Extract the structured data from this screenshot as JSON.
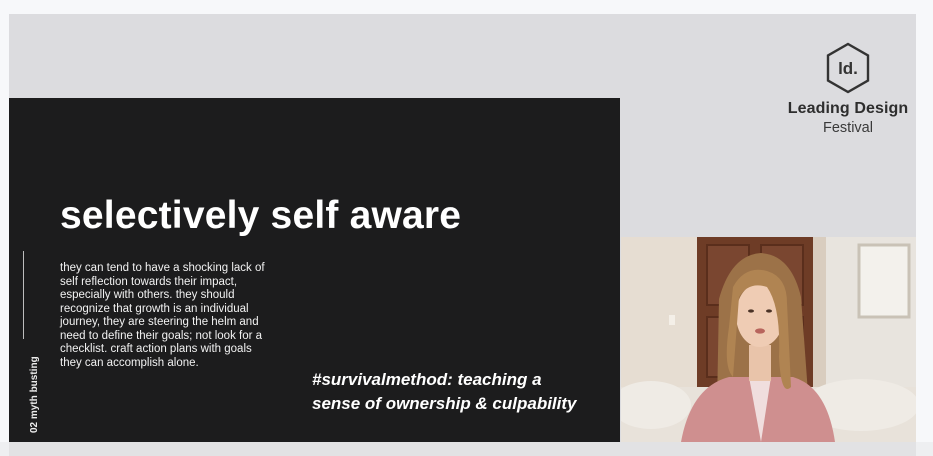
{
  "brand": {
    "name": "Leading Design",
    "sub": "Festival",
    "logo_text": "ld."
  },
  "slide": {
    "title": "selectively self aware",
    "side_label": "02 myth busting",
    "body": "they can tend to have a shocking lack of self reflection towards their impact, especially with others. they should recognize that growth is an individual journey, they are steering the helm and need to define their goals; not look for a checklist. craft action plans with goals they can accomplish alone.",
    "hashtag_line1": "#survivalmethod: teaching a",
    "hashtag_line2": "sense of ownership & culpability"
  },
  "colors": {
    "stage_bg": "#dcdcdf",
    "slide_bg": "#1c1c1d",
    "text_light": "#ffffff",
    "brand_text": "#333333"
  }
}
